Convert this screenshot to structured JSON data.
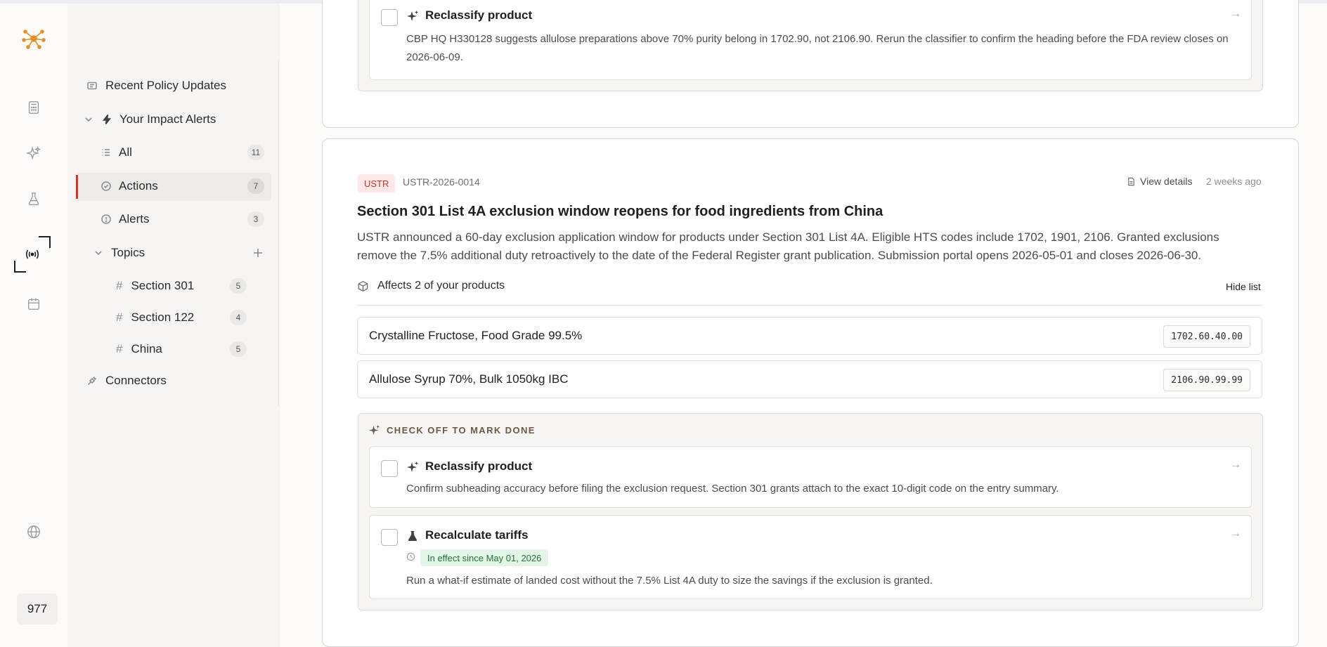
{
  "rail": {
    "count": "977"
  },
  "sidebar": {
    "recent": "Recent Policy Updates",
    "impact": "Your Impact Alerts",
    "all": {
      "label": "All",
      "count": "11"
    },
    "actions": {
      "label": "Actions",
      "count": "7"
    },
    "alerts": {
      "label": "Alerts",
      "count": "3"
    },
    "topics": "Topics",
    "topic_items": [
      {
        "label": "Section 301",
        "count": "5"
      },
      {
        "label": "Section 122",
        "count": "4"
      },
      {
        "label": "China",
        "count": "5"
      }
    ],
    "connectors": "Connectors"
  },
  "top_card": {
    "task_title": "Reclassify product",
    "task_desc": "CBP HQ H330128 suggests allulose preparations above 70% purity belong in 1702.90, not 2106.90. Rerun the classifier to confirm the heading before the FDA review closes on 2026-06-09.",
    "arrow": "→"
  },
  "update": {
    "source": "USTR",
    "ref": "USTR-2026-0014",
    "view_details": "View details",
    "age": "2 weeks ago",
    "title": "Section 301 List 4A exclusion window reopens for food ingredients from China",
    "body": "USTR announced a 60-day exclusion application window for products under Section 301 List 4A. Eligible HTS codes include 1702, 1901, 2106. Granted exclusions remove the 7.5% additional duty retroactively to the date of the Federal Register grant publication. Submission portal opens 2026-05-01 and closes 2026-06-30.",
    "affects": "Affects 2 of your products",
    "hide_list": "Hide list",
    "products": [
      {
        "name": "Crystalline Fructose, Food Grade 99.5%",
        "hts": "1702.60.40.00"
      },
      {
        "name": "Allulose Syrup 70%, Bulk 1050kg IBC",
        "hts": "2106.90.99.99"
      }
    ],
    "checklist_head": "CHECK OFF TO MARK DONE",
    "tasks": [
      {
        "title": "Reclassify product",
        "desc": "Confirm subheading accuracy before filing the exclusion request. Section 301 grants attach to the exact 10-digit code on the entry summary.",
        "arrow": "→"
      },
      {
        "title": "Recalculate tariffs",
        "effect": "In effect since May 01, 2026",
        "desc": "Run a what-if estimate of landed cost without the 7.5% List 4A duty to size the savings if the exclusion is granted.",
        "arrow": "→"
      }
    ]
  },
  "colors": {
    "accent": "#d9352b",
    "logo": "#e0912c",
    "tag_bg": "#fde7e7",
    "effect_bg": "#e3f5e6"
  }
}
